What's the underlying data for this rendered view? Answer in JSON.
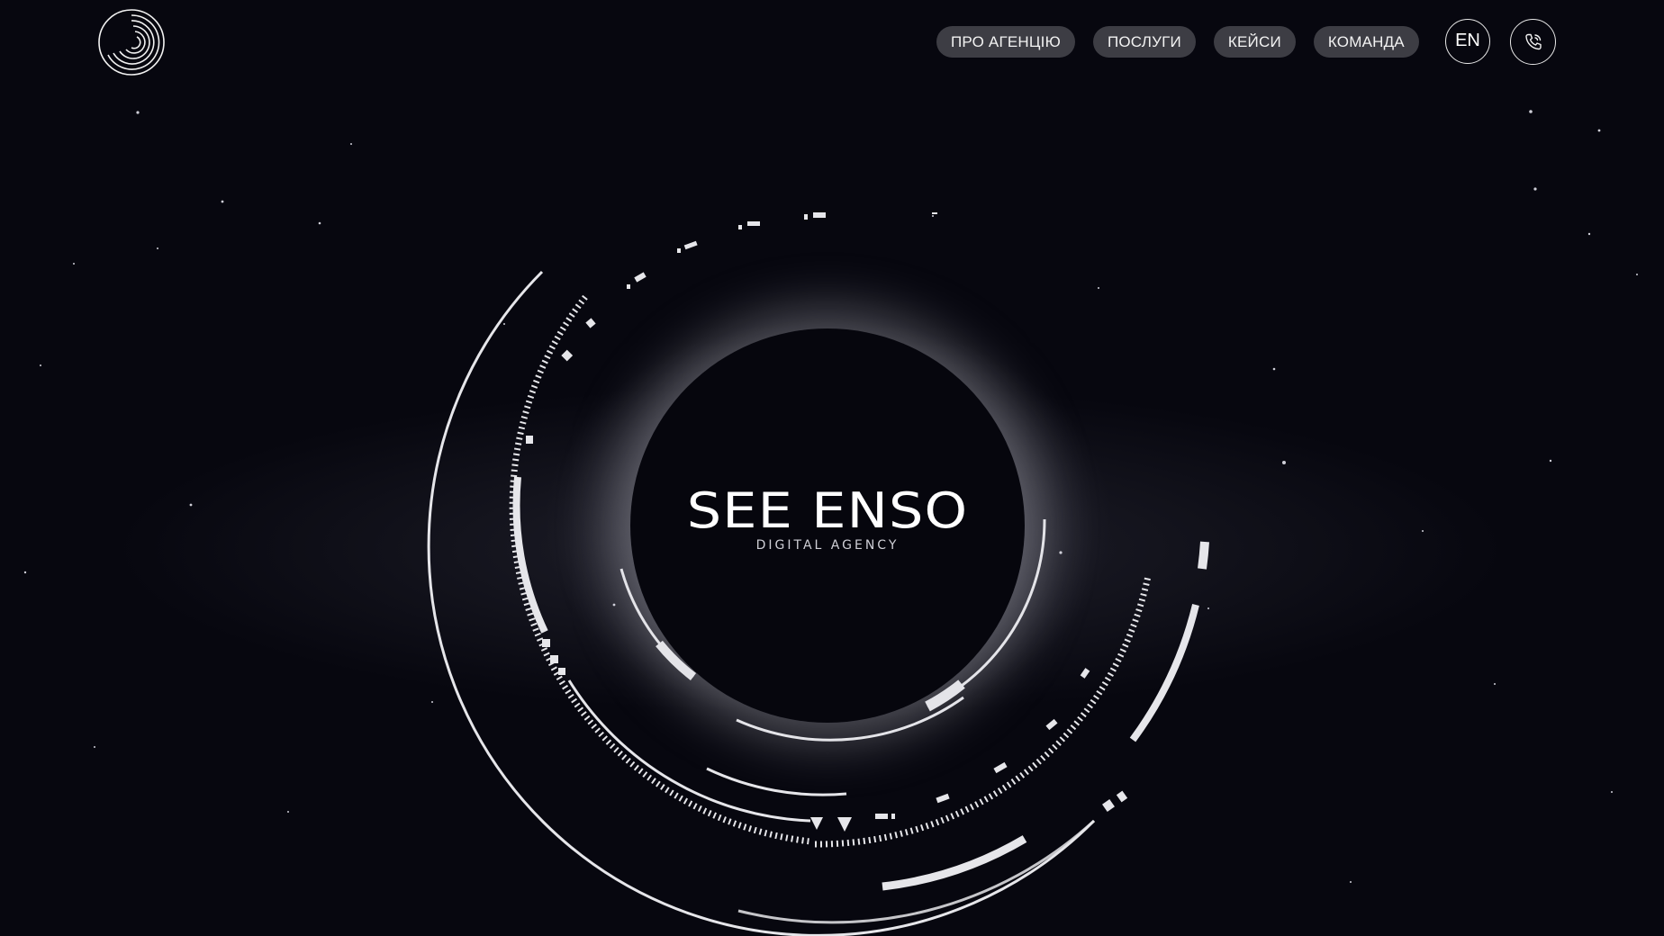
{
  "header": {
    "logo": "spiral-logo",
    "nav": [
      {
        "label": "ПРО АГЕНЦІЮ"
      },
      {
        "label": "ПОСЛУГИ"
      },
      {
        "label": "КЕЙСИ"
      },
      {
        "label": "КОМАНДА"
      }
    ],
    "language": "EN",
    "phone_icon": "phone-icon"
  },
  "hero": {
    "title": "SEE ENSO",
    "subtitle": "DIGITAL AGENCY"
  },
  "colors": {
    "background": "#07070f",
    "nav_pill": "#46464e",
    "text": "#ffffff",
    "glow": "#d2d2dc"
  }
}
